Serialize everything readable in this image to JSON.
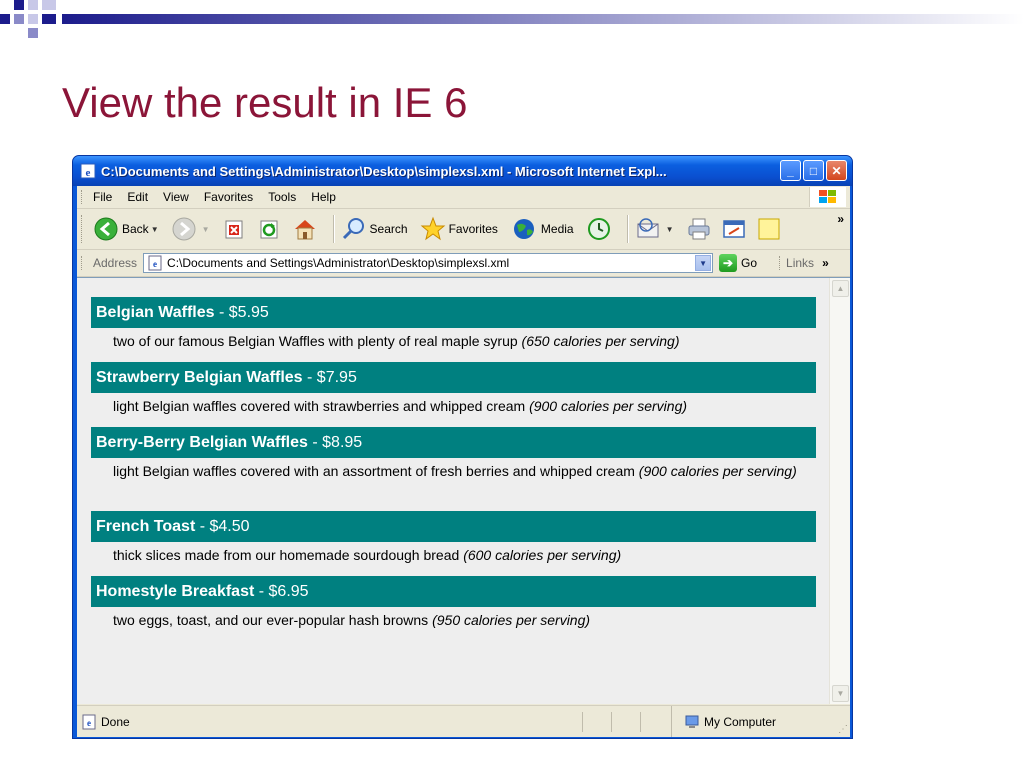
{
  "slide": {
    "title": "View the result in IE 6",
    "colors": {
      "title": "#8b1538",
      "banner_start": "#1c1c8c",
      "banner_end": "#ffffff"
    }
  },
  "window": {
    "title": "C:\\Documents and Settings\\Administrator\\Desktop\\simplexsl.xml - Microsoft Internet Expl...",
    "icons": {
      "app": "ie-icon",
      "minimize": "minimize-icon",
      "maximize": "maximize-icon",
      "close": "close-icon"
    }
  },
  "menu": {
    "items": [
      {
        "label": "File",
        "icon": "none"
      },
      {
        "label": "Edit",
        "icon": "none"
      },
      {
        "label": "View",
        "icon": "none"
      },
      {
        "label": "Favorites",
        "icon": "none"
      },
      {
        "label": "Tools",
        "icon": "none"
      },
      {
        "label": "Help",
        "icon": "none"
      }
    ]
  },
  "toolbar": {
    "back_label": "Back",
    "search_label": "Search",
    "favorites_label": "Favorites",
    "media_label": "Media",
    "overflow": "»"
  },
  "address": {
    "label": "Address",
    "value": "C:\\Documents and Settings\\Administrator\\Desktop\\simplexsl.xml",
    "go_label": "Go",
    "links_label": "Links",
    "links_overflow": "»"
  },
  "menu_items": [
    {
      "name": "Belgian Waffles",
      "price": " - $5.95",
      "description": "two of our famous Belgian Waffles with plenty of real maple syrup ",
      "calories": "(650 calories per serving)"
    },
    {
      "name": "Strawberry Belgian Waffles",
      "price": " - $7.95",
      "description": "light Belgian waffles covered with strawberries and whipped cream ",
      "calories": "(900 calories per serving)"
    },
    {
      "name": "Berry-Berry Belgian Waffles",
      "price": " - $8.95",
      "description": "light Belgian waffles covered with an assortment of fresh berries and whipped cream ",
      "calories": "(900 calories per serving)"
    },
    {
      "name": "French Toast",
      "price": " - $4.50",
      "description": "thick slices made from our homemade sourdough bread ",
      "calories": "(600 calories per serving)"
    },
    {
      "name": "Homestyle Breakfast",
      "price": " - $6.95",
      "description": "two eggs, toast, and our ever-popular hash browns ",
      "calories": "(950 calories per serving)"
    }
  ],
  "status": {
    "text": "Done",
    "zone": "My Computer"
  },
  "colors": {
    "header_bg": "#008080",
    "content_bg": "#eeeeee",
    "titlebar": "#0a58d8"
  }
}
